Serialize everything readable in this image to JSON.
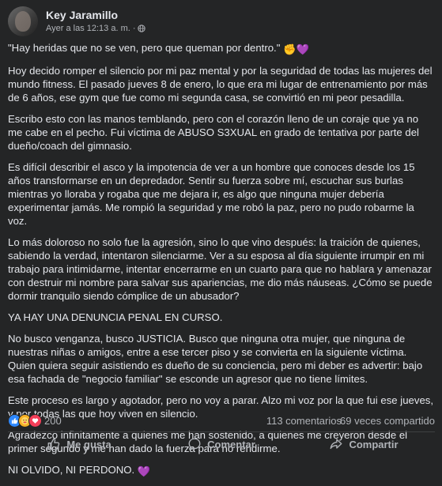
{
  "post": {
    "author": "Key Jaramillo",
    "timestamp": "Ayer a las 12:13 a. m.",
    "separator": "·",
    "paragraphs": [
      "\"Hay heridas que no se ven, pero que queman por dentro.\"",
      "Hoy decido romper el silencio por mi paz mental y por la seguridad de todas las mujeres del mundo fitness. El pasado jueves 8 de enero, lo que era mi lugar de entrenamiento por más de 6 años, ese gym que fue como mi segunda casa, se convirtió en mi peor pesadilla.",
      "Escribo esto con las manos temblando, pero con el corazón lleno de un coraje que ya no me cabe en el pecho. Fui víctima de ABUSO S3XUAL en grado de tentativa por parte del dueño/coach del gimnasio.",
      "Es difícil describir el asco y la impotencia de ver a un hombre que conoces desde los 15 años transformarse en un depredador. Sentir su fuerza sobre mí, escuchar sus burlas mientras yo lloraba y rogaba que me dejara ir, es algo que ninguna mujer debería experimentar jamás. Me rompió la seguridad y me robó la paz, pero no pudo robarme la voz.",
      "Lo más doloroso no solo fue la agresión, sino lo que vino después: la traición de quienes, sabiendo la verdad, intentaron silenciarme. Ver a su esposa al día siguiente irrumpir en mi trabajo para intimidarme, intentar encerrarme en un cuarto para que no hablara y amenazar con destruir mi nombre para salvar sus apariencias, me dio más náuseas. ¿Cómo se puede dormir tranquilo siendo cómplice de un abusador?",
      "YA HAY UNA DENUNCIA PENAL EN CURSO.",
      "No busco venganza, busco JUSTICIA. Busco que ninguna otra mujer, que ninguna de nuestras niñas o amigos, entre a ese tercer piso y se convierta en la siguiente víctima. Quien quiera seguir asistiendo es dueño de su conciencia, pero mi deber es advertir: bajo esa fachada de \"negocio familiar\" se esconde un agresor que no tiene límites.",
      "Este proceso es largo y agotador, pero no voy a parar. Alzo mi voz por la que fui ese jueves, y por todas las que hoy viven en silencio.",
      "Agradezco infinitamente a quienes me han sostenido, a quienes me creyeron desde el primer segundo y me han dado la fuerza para no rendirme.",
      "NI OLVIDO, NI PERDONO."
    ],
    "first_line_emojis": [
      "✊",
      "💜"
    ],
    "last_line_emoji": "💜"
  },
  "stats": {
    "reaction_count": "200",
    "comments": "113 comentarios",
    "shares": "69 veces compartido"
  },
  "actions": {
    "like": "Me gusta",
    "comment": "Comentar",
    "share": "Compartir"
  },
  "colors": {
    "background": "#242526",
    "text": "#e4e6eb",
    "secondary": "#b0b3b8",
    "like_blue": "#2d88ff",
    "love_red": "#f33e58",
    "care_yellow": "#f7b125"
  }
}
